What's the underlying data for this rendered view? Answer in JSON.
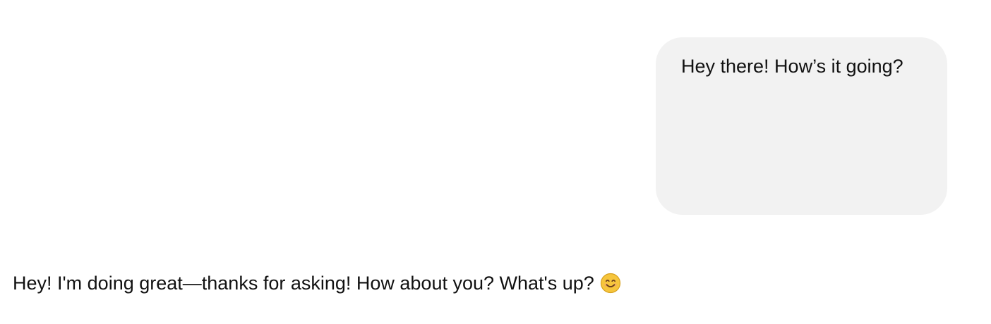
{
  "conversation": {
    "user_message": {
      "text": "Hey there! How’s it going?"
    },
    "assistant_message": {
      "text": "Hey! I'm doing great—thanks for asking! How about you? What's up?",
      "emoji_icon": "smiling-face-with-smiling-eyes-icon"
    }
  },
  "colors": {
    "background": "#ffffff",
    "user_bubble": "#f2f2f2",
    "text": "#111111",
    "emoji_face": "#f6c53c",
    "emoji_feature": "#6a3d1d",
    "emoji_blush": "#f29b7a"
  }
}
